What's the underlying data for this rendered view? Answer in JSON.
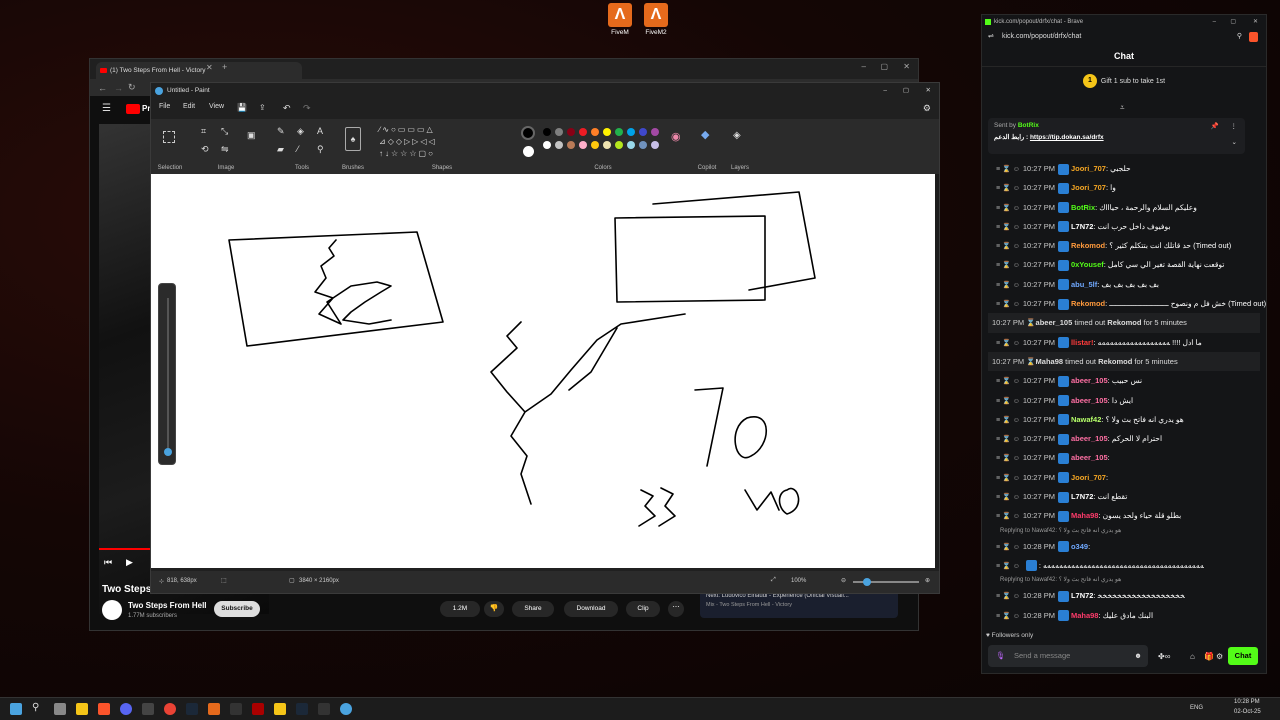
{
  "desktop": {
    "icons": [
      {
        "label": "FiveM"
      },
      {
        "label": "FiveM2"
      }
    ]
  },
  "browser": {
    "tab_title": "(1) Two Steps From Hell - Victory",
    "youtube_logo_partial": "Pr",
    "video_title_partial": "Two Steps",
    "channel_name": "Two Steps From Hell",
    "subscribers": "1.77M subscribers",
    "subscribe_label": "Subscribe",
    "likes": "1.2M",
    "share_label": "Share",
    "download_label": "Download",
    "clip_label": "Clip",
    "next_label": "Next: Ludovico Einaudi - Experience (Official Visuali...",
    "mix_label": "Mix - Two Steps From Hell - Victory"
  },
  "paint": {
    "title": "Untitled - Paint",
    "menu": {
      "file": "File",
      "edit": "Edit",
      "view": "View"
    },
    "groups": {
      "selection": "Selection",
      "image": "Image",
      "tools": "Tools",
      "brushes": "Brushes",
      "shapes": "Shapes",
      "colors": "Colors",
      "copilot": "Copilot",
      "layers": "Layers"
    },
    "status": {
      "cursor": "818, 638px",
      "dimensions": "3840 × 2160px",
      "zoom": "100%"
    },
    "palette": [
      "#000000",
      "#7f7f7f",
      "#880015",
      "#ed1c24",
      "#ff7f27",
      "#fff200",
      "#22b14c",
      "#00a2e8",
      "#3f48cc",
      "#a349a4",
      "#ffffff",
      "#c3c3c3",
      "#b97a57",
      "#ffaec9",
      "#ffc90e",
      "#efe4b0",
      "#b5e61d",
      "#99d9ea",
      "#7092be",
      "#c8bfe7"
    ],
    "canvas_text": {
      "n70": "70",
      "n33": "33",
      "scribble": "ИO"
    }
  },
  "kick": {
    "window_title": "kick.com/popout/drfx/chat - Brave",
    "address": "kick.com/popout/drfx/chat",
    "header": "Chat",
    "gift": {
      "badge": "1",
      "text": "Gift 1 sub to take 1st"
    },
    "pinned": {
      "sent_by": "Sent by",
      "sender": "BotRix",
      "label": "رابط الدعم :",
      "link": "https://tip.dokan.sa/drfx"
    },
    "messages": [
      {
        "kind": "msg",
        "time": "10:27 PM",
        "user": "Joori_707",
        "color": "#f5a623",
        "text": "حلجبي"
      },
      {
        "kind": "msg",
        "time": "10:27 PM",
        "user": "Joori_707",
        "color": "#f5a623",
        "text": "وا"
      },
      {
        "kind": "msg",
        "time": "10:27 PM",
        "user": "BotRix",
        "color": "#53fc18",
        "text": "وعليكم السلام والرحمة ، حياااك"
      },
      {
        "kind": "msg",
        "time": "10:27 PM",
        "user": "L7N72",
        "color": "#ffffff",
        "text": "بوفيوف داخل حرب انت"
      },
      {
        "kind": "msg",
        "time": "10:27 PM",
        "user": "Rekomod",
        "color": "#ff9a3c",
        "text": "حد قاتلك انت بتتكلم كثير ؟ (Timed out)"
      },
      {
        "kind": "msg",
        "time": "10:27 PM",
        "user": "0xYousef",
        "color": "#53fc18",
        "text": "توقعت نهاية القصة تغير الي سي كامل"
      },
      {
        "kind": "msg",
        "time": "10:27 PM",
        "user": "abu_5lf",
        "color": "#6fa8ff",
        "text": "بف بف بف بف بف"
      },
      {
        "kind": "msg",
        "time": "10:27 PM",
        "user": "Rekomod",
        "color": "#ff9a3c",
        "text": "خش فل م ونصوح ـــــــــــــــــــــــــــ (Timed out)"
      },
      {
        "kind": "sys",
        "time": "10:27 PM",
        "user": "abeer_105",
        "text": "timed out",
        "target": "Rekomod",
        "suffix": "for 5 minutes"
      },
      {
        "kind": "msg",
        "time": "10:27 PM",
        "user": "llistar!",
        "color": "#ff3b3b",
        "text": "ما ادل !!!! ﻪﻪﻪﻪﻪﻪﻪﻪﻪﻪﻪﻪﻪﻪﻪﻪﻪﻪ"
      },
      {
        "kind": "sys",
        "time": "10:27 PM",
        "user": "Maha98",
        "text": "timed out",
        "target": "Rekomod",
        "suffix": "for 5 minutes"
      },
      {
        "kind": "msg",
        "time": "10:27 PM",
        "user": "abeer_105",
        "color": "#ff6fa3",
        "text": "نس حبيب"
      },
      {
        "kind": "msg",
        "time": "10:27 PM",
        "user": "abeer_105",
        "color": "#ff6fa3",
        "text": "ايش دا"
      },
      {
        "kind": "msg",
        "time": "10:27 PM",
        "user": "Nawaf42",
        "color": "#b6ff6a",
        "text": "هو يدري انه فاتح بث ولا ؟"
      },
      {
        "kind": "msg",
        "time": "10:27 PM",
        "user": "abeer_105",
        "color": "#ff6fa3",
        "text": "احترام لا الحركم"
      },
      {
        "kind": "msg",
        "time": "10:27 PM",
        "user": "abeer_105",
        "color": "#ff6fa3",
        "text": ""
      },
      {
        "kind": "msg",
        "time": "10:27 PM",
        "user": "Joori_707",
        "color": "#f5a623",
        "text": ""
      },
      {
        "kind": "msg",
        "time": "10:27 PM",
        "user": "L7N72",
        "color": "#ffffff",
        "text": "تقطع انت"
      },
      {
        "kind": "msg",
        "time": "10:27 PM",
        "user": "Maha98",
        "color": "#ff3b6b",
        "text": "بطلو قلة حياء ولحد يسون"
      },
      {
        "kind": "reply",
        "text": "Replying to Nawaf42: هو يدري انه فاتح بث ولا ؟"
      },
      {
        "kind": "msg",
        "time": "10:28 PM",
        "user": "o349",
        "color": "#6fa8ff",
        "text": ""
      },
      {
        "kind": "msg",
        "time": "",
        "user": "",
        "color": "#ffffff",
        "text": "ﻪﻪﻪﻪﻪﻪﻪﻪﻪﻪﻪﻪﻪﻪﻪﻪﻪﻪﻪﻪﻪﻪﻪﻪﻪﻪﻪﻪﻪﻪﻪﻪﻪﻪﻪﻪﻪﻪﻪﻪ"
      },
      {
        "kind": "reply",
        "text": "Replying to Nawaf42: هو يدري انه فاتح بث ولا ؟"
      },
      {
        "kind": "msg",
        "time": "10:28 PM",
        "user": "L7N72",
        "color": "#ffffff",
        "text": "ﺨﺨﺨﺨﺨﺨﺨﺨﺨﺨﺨﺨﺨﺨﺨﺨﺨﺨ"
      },
      {
        "kind": "msg",
        "time": "10:28 PM",
        "user": "Maha98",
        "color": "#ff3b6b",
        "text": "البنك مادق عليك"
      }
    ],
    "followers_only": "Followers only",
    "input_placeholder": "Send a message",
    "chat_button": "Chat"
  },
  "taskbar": {
    "lang": "ENG",
    "time": "10:28 PM",
    "date": "02-Oct-25"
  }
}
